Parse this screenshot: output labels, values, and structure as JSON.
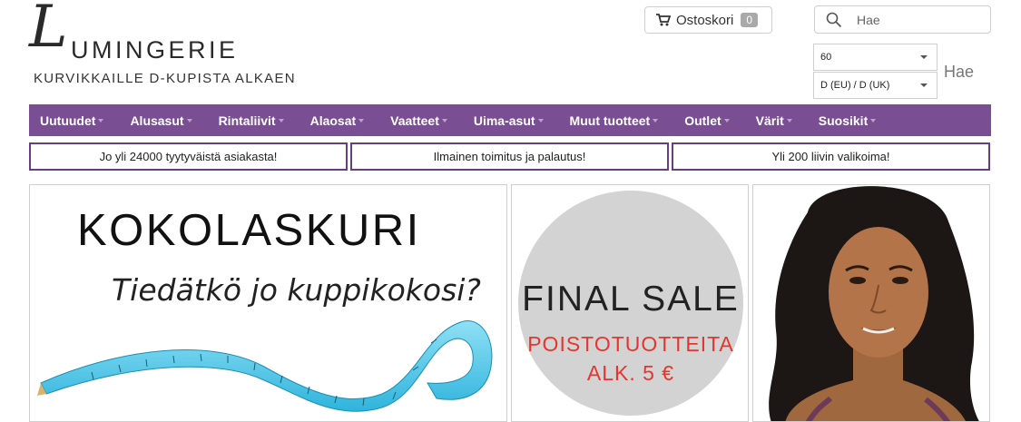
{
  "logo": {
    "initial": "L",
    "word": "UMINGERIE",
    "tagline": "KURVIKKAILLE D-KUPISTA ALKAEN"
  },
  "cart": {
    "label": "Ostoskori",
    "count": "0",
    "icon": "cart-icon"
  },
  "search": {
    "placeholder": "Hae",
    "icon": "search-icon",
    "button_label": "Hae"
  },
  "size_selects": {
    "band": "60",
    "cup": "D (EU) / D (UK)"
  },
  "nav": {
    "items": [
      "Uutuudet",
      "Alusasut",
      "Rintaliivit",
      "Alaosat",
      "Vaatteet",
      "Uima-asut",
      "Muut tuotteet",
      "Outlet",
      "Värit",
      "Suosikit"
    ],
    "background": "#7a4e93"
  },
  "info_bar": [
    "Jo yli 24000 tyytyväistä asiakasta!",
    "Ilmainen toimitus ja palautus!",
    "Yli 200 liivin valikoima!"
  ],
  "banners": {
    "size_calc": {
      "title": "KOKOLASKURI",
      "subtitle": "Tiedätkö jo kuppikokosi?"
    },
    "final_sale": {
      "title": "FINAL SALE",
      "line1": "POISTOTUOTTEITA",
      "line2": "ALK. 5 €",
      "accent": "#e8342d"
    },
    "model": {}
  }
}
